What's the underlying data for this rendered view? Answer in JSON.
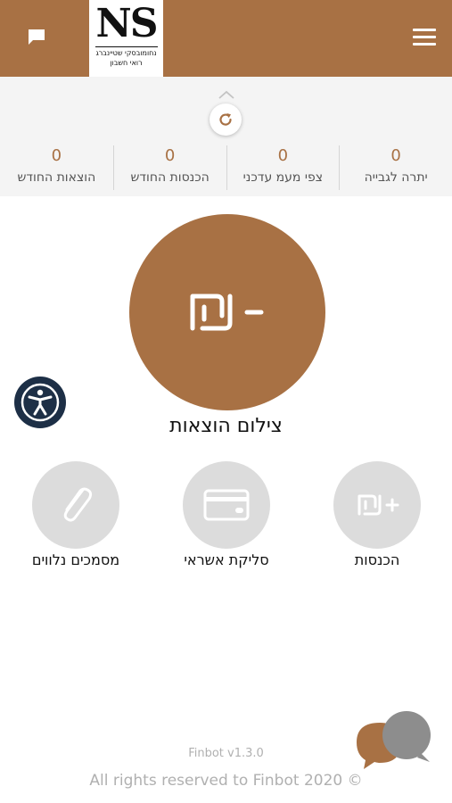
{
  "header": {
    "logo_text": "NS",
    "logo_line1": "נחומובסקי שטיינברג",
    "logo_line2": "רואי חשבון"
  },
  "stats": [
    {
      "value": "0",
      "label": "יתרה לגבייה"
    },
    {
      "value": "0",
      "label": "צפי מעמ עדכני"
    },
    {
      "value": "0",
      "label": "הכנסות החודש"
    },
    {
      "value": "0",
      "label": "הוצאות החודש"
    }
  ],
  "main_action": {
    "label": "צילום הוצאות"
  },
  "actions": {
    "income": {
      "label": "הכנסות"
    },
    "credit": {
      "label": "סליקת אשראי"
    },
    "documents": {
      "label": "מסמכים נלווים"
    }
  },
  "footer": {
    "version": "Finbot v1.3.0",
    "copyright": "All rights reserved to Finbot 2020 ©"
  },
  "colors": {
    "brand": "#a87144",
    "accessibility": "#1d2f46",
    "action_bg": "#dcdcdc"
  }
}
